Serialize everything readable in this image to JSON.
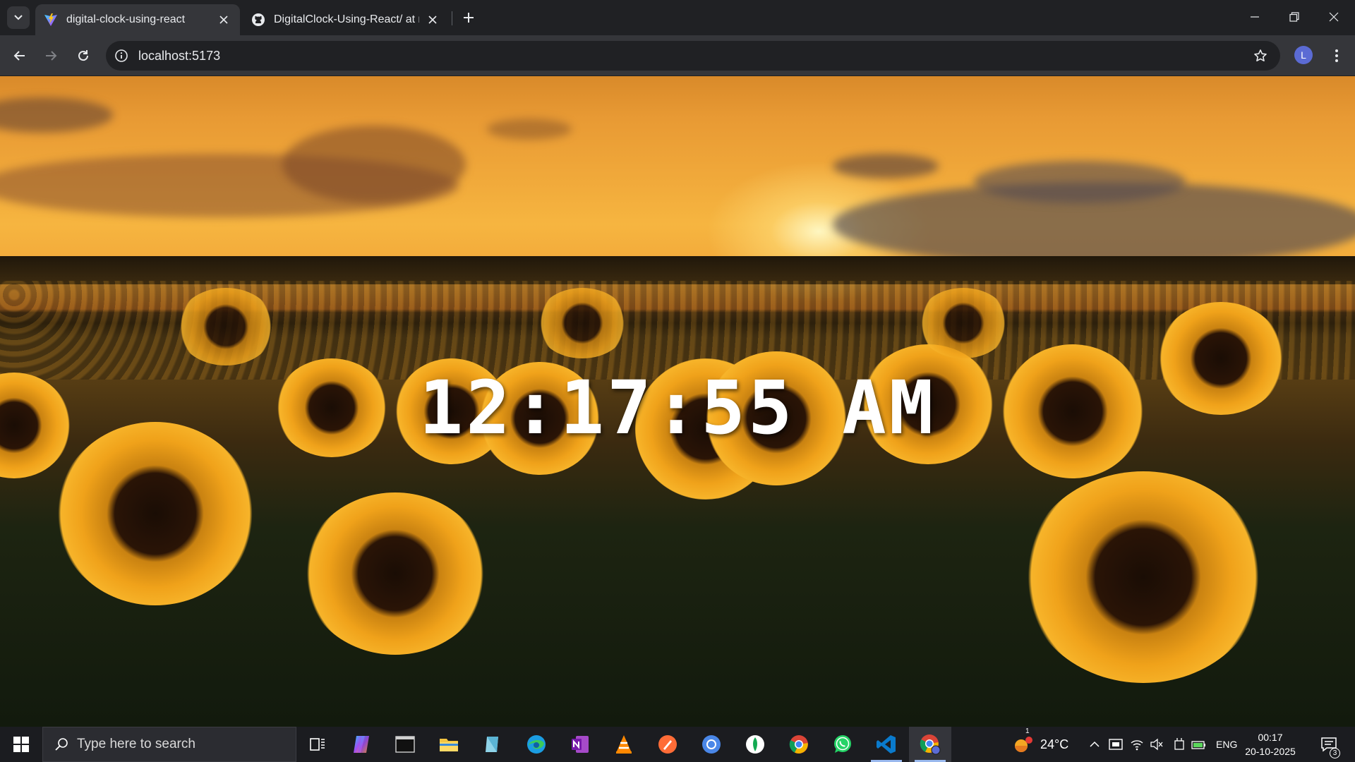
{
  "browser": {
    "tabs": [
      {
        "title": "digital-clock-using-react",
        "active": true,
        "favicon": "vite-logo-icon"
      },
      {
        "title": "DigitalClock-Using-React/ at m",
        "active": false,
        "favicon": "github-icon"
      }
    ],
    "url": "localhost:5173",
    "profile_initial": "L"
  },
  "page": {
    "clock_time": "12:17:55 AM",
    "background": "sunflower-field-at-sunset"
  },
  "taskbar": {
    "search_placeholder": "Type here to search",
    "apps": [
      "task-view-icon",
      "copilot-icon",
      "terminal-icon",
      "file-explorer-icon",
      "notepad-icon",
      "edge-icon",
      "onenote-icon",
      "vlc-icon",
      "postman-icon",
      "chromium-icon",
      "mongodb-compass-icon",
      "chrome-icon",
      "whatsapp-icon",
      "vscode-icon",
      "chrome-profile-icon"
    ],
    "weather_temp": "24°C",
    "weather_badge": "1",
    "language": "ENG",
    "time": "00:17",
    "date": "20-10-2025",
    "notification_count": "3"
  }
}
